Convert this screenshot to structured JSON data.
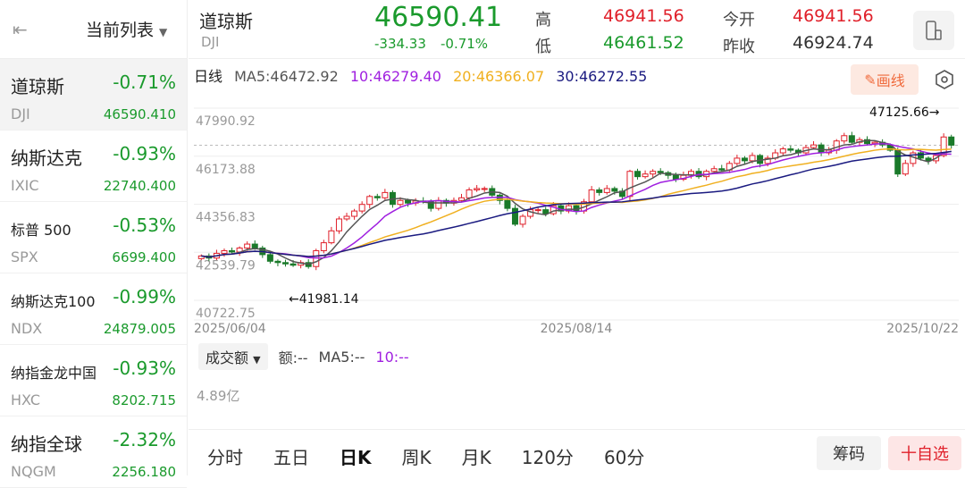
{
  "sidebar": {
    "title": "当前列表",
    "items": [
      {
        "name": "道琼斯",
        "code": "DJI",
        "pct": "-0.71%",
        "price": "46590.410"
      },
      {
        "name": "纳斯达克",
        "code": "IXIC",
        "pct": "-0.93%",
        "price": "22740.400"
      },
      {
        "name": "标普 500",
        "code": "SPX",
        "pct": "-0.53%",
        "price": "6699.400"
      },
      {
        "name": "纳斯达克100",
        "code": "NDX",
        "pct": "-0.99%",
        "price": "24879.005"
      },
      {
        "name": "纳指金龙中国",
        "code": "HXC",
        "pct": "-0.93%",
        "price": "8202.715"
      },
      {
        "name": "纳指全球",
        "code": "NQGM",
        "pct": "-2.32%",
        "price": "2256.180"
      }
    ]
  },
  "header": {
    "name": "道琼斯",
    "code": "DJI",
    "price": "46590.41",
    "change": "-334.33",
    "pct": "-0.71%",
    "high_label": "高",
    "high": "46941.56",
    "low_label": "低",
    "low": "46461.52",
    "open_label": "今开",
    "open": "46941.56",
    "prev_label": "昨收",
    "prev": "46924.74"
  },
  "ma_legend": {
    "period": "日线",
    "ma5": "MA5:46472.92",
    "ma10": "10:46279.40",
    "ma20": "20:46366.07",
    "ma30": "30:46272.55"
  },
  "draw_button": "画线",
  "colors": {
    "up": "#e0202a",
    "down": "#1a7a2a",
    "ma5": "#555555",
    "ma10": "#a020e0",
    "ma20": "#f0b020",
    "ma30": "#1a1a80"
  },
  "chart_data": {
    "type": "candlestick",
    "y_ticks": [
      "47990.92",
      "46173.88",
      "44356.83",
      "42539.79",
      "40722.75"
    ],
    "ylim": [
      40722.75,
      47990.92
    ],
    "x_ticks": [
      "2025/06/04",
      "2025/08/14",
      "2025/10/22"
    ],
    "max_label": "47125.66→",
    "min_label": "←41981.14",
    "max_value": 47125.66,
    "min_value": 41981.14,
    "close": [
      42400,
      42320,
      42500,
      42600,
      42550,
      42700,
      42850,
      42700,
      42450,
      42200,
      42150,
      42100,
      42050,
      42150,
      42000,
      42600,
      42900,
      43350,
      43800,
      43900,
      44100,
      44350,
      44650,
      44600,
      44800,
      44350,
      44500,
      44400,
      44480,
      44450,
      44200,
      44500,
      44400,
      44500,
      44600,
      44900,
      44950,
      44950,
      44700,
      44500,
      44200,
      43600,
      43900,
      44150,
      44150,
      44000,
      44300,
      44100,
      44300,
      44100,
      44450,
      44900,
      44800,
      44950,
      44850,
      44650,
      45600,
      45400,
      45500,
      45600,
      45550,
      45450,
      45300,
      45450,
      45600,
      45400,
      45600,
      45700,
      45650,
      45900,
      46100,
      46000,
      46200,
      45900,
      46100,
      46300,
      46450,
      46400,
      46300,
      46500,
      46600,
      46300,
      46400,
      46750,
      46950,
      46700,
      46800,
      46650,
      46700,
      46600,
      46400,
      45500,
      45900,
      46300,
      46100,
      46000,
      46200,
      46900,
      46590
    ],
    "open_first": 42300
  },
  "volume": {
    "selector": "成交额",
    "amount": "额:--",
    "ma5": "MA5:--",
    "ma10": "10:--",
    "axis": "4.89亿"
  },
  "tabs": [
    "分时",
    "五日",
    "日K",
    "周K",
    "月K",
    "120分",
    "60分"
  ],
  "buttons": {
    "chips": "筹码",
    "watch": "十自选"
  }
}
